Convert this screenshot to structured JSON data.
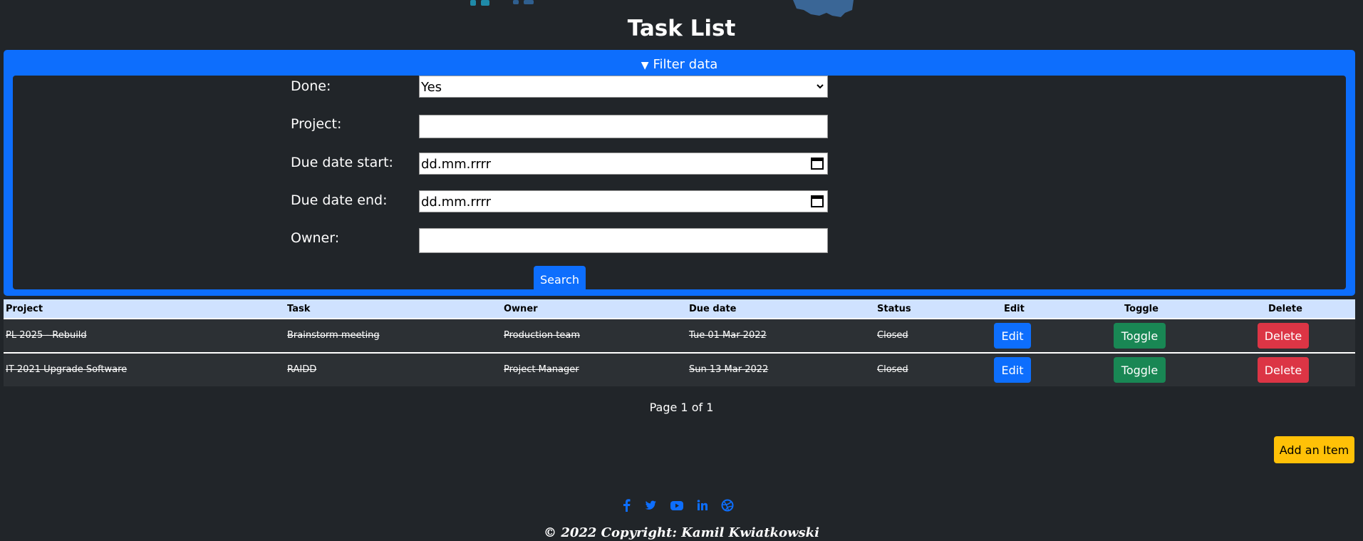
{
  "page": {
    "title": "Task List",
    "pager": "Page 1 of 1",
    "add_item_label": "Add an Item",
    "copyright": "© 2022 Copyright: Kamil Kwiatkowski"
  },
  "filter": {
    "summary": "Filter data",
    "done_label": "Done:",
    "done_value": "Yes",
    "project_label": "Project:",
    "project_value": "",
    "due_start_label": "Due date start:",
    "due_start_value": "dd.mm.rrrr",
    "due_end_label": "Due date end:",
    "due_end_value": "dd.mm.rrrr",
    "owner_label": "Owner:",
    "owner_value": "",
    "search_label": "Search"
  },
  "table": {
    "headers": [
      "Project",
      "Task",
      "Owner",
      "Due date",
      "Status",
      "Edit",
      "Toggle",
      "Delete"
    ],
    "rows": [
      {
        "project": "PL 2025 - Rebuild",
        "task": "Brainstorm meeting",
        "owner": "Production team",
        "due": "Tue 01 Mar 2022",
        "status": "Closed",
        "edit": "Edit",
        "toggle": "Toggle",
        "delete": "Delete"
      },
      {
        "project": "IT 2021 Upgrade Software",
        "task": "RAIDD",
        "owner": "Project Manager",
        "due": "Sun 13 Mar 2022",
        "status": "Closed",
        "edit": "Edit",
        "toggle": "Toggle",
        "delete": "Delete"
      }
    ]
  },
  "social_icons": [
    "facebook-icon",
    "twitter-icon",
    "youtube-icon",
    "linkedin-icon",
    "dribbble-icon"
  ],
  "colors": {
    "background": "#212529",
    "primary": "#0d6efd",
    "success": "#198754",
    "danger": "#dc3545",
    "warning": "#ffc107",
    "table_header": "#cfe2ff"
  }
}
